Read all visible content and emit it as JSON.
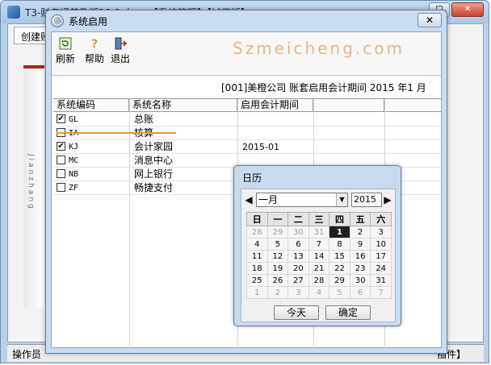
{
  "background_app": {
    "title": "T3-财务通普及版10.9 小 ... 【系统管理】【试用版】",
    "tab": "创建账",
    "side_text": "Jianzhang",
    "status_left": "操作员",
    "status_right": "插件】"
  },
  "dialog": {
    "title": "系统启用",
    "close_label": "✕",
    "toolbar": [
      {
        "label": "刷新",
        "icon": "refresh-icon"
      },
      {
        "label": "帮助",
        "icon": "help-icon"
      },
      {
        "label": "退出",
        "icon": "exit-icon"
      }
    ],
    "watermark": "Szmeicheng.com",
    "account_info": "[001]美橙公司 账套启用会计期间 2015 年1 月",
    "columns": [
      "系统编码",
      "系统名称",
      "启用会计期间",
      ""
    ],
    "rows": [
      {
        "checked": "✔",
        "code": "GL",
        "name": "总账",
        "period": ""
      },
      {
        "checked": "",
        "code": "IA",
        "name": "核算",
        "period": ""
      },
      {
        "checked": "✔",
        "code": "KJ",
        "name": "会计家园",
        "period": "2015-01"
      },
      {
        "checked": "",
        "code": "MC",
        "name": "消息中心",
        "period": ""
      },
      {
        "checked": "",
        "code": "NB",
        "name": "网上银行",
        "period": ""
      },
      {
        "checked": "",
        "code": "ZF",
        "name": "畅捷支付",
        "period": ""
      }
    ]
  },
  "calendar": {
    "title": "日历",
    "month": "一月",
    "year": "2015",
    "prev_arrow": "◀",
    "next_arrow": "▶",
    "weekdays": [
      "日",
      "一",
      "二",
      "三",
      "四",
      "五",
      "六"
    ],
    "weeks": [
      [
        "28",
        "29",
        "30",
        "31",
        "1",
        "2",
        "3"
      ],
      [
        "4",
        "5",
        "6",
        "7",
        "8",
        "9",
        "10"
      ],
      [
        "11",
        "12",
        "13",
        "14",
        "15",
        "16",
        "17"
      ],
      [
        "18",
        "19",
        "20",
        "21",
        "22",
        "23",
        "24"
      ],
      [
        "25",
        "26",
        "27",
        "28",
        "29",
        "30",
        "31"
      ],
      [
        "1",
        "2",
        "3",
        "4",
        "5",
        "6",
        "7"
      ]
    ],
    "selected": "1",
    "today_button": "今天",
    "ok_button": "确定"
  }
}
